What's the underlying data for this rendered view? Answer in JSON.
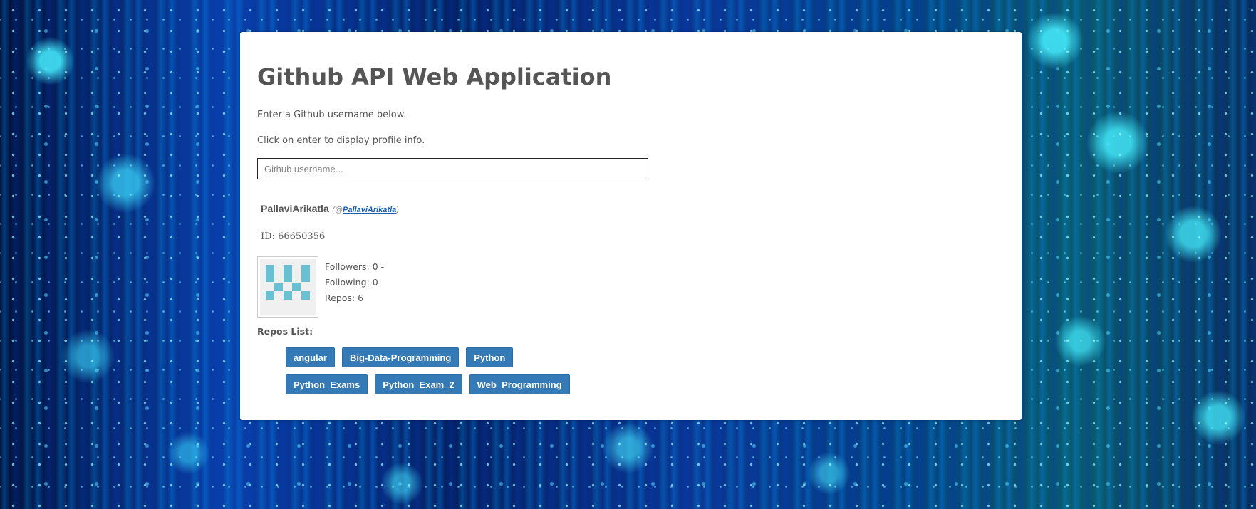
{
  "app": {
    "title": "Github API Web Application",
    "instructions": [
      "Enter a Github username below.",
      "Click on enter to display profile info."
    ]
  },
  "search": {
    "placeholder": "Github username...",
    "value": ""
  },
  "profile": {
    "name": "PallaviArikatla",
    "handle_prefix": "(@",
    "login": "PallaviArikatla",
    "handle_suffix": ")",
    "id_text": "ID: 66650356",
    "followers_text": "Followers: 0 -",
    "following_text": "Following: 0",
    "repos_text": "Repos: 6",
    "avatar_color": "#6ac0d3"
  },
  "repos": {
    "heading": "Repos List:",
    "items": [
      "angular",
      "Big-Data-Programming",
      "Python",
      "Python_Exams",
      "Python_Exam_2",
      "Web_Programming"
    ]
  },
  "colors": {
    "button": "#337ab7",
    "text": "#555555",
    "link": "#1a5fb4"
  }
}
